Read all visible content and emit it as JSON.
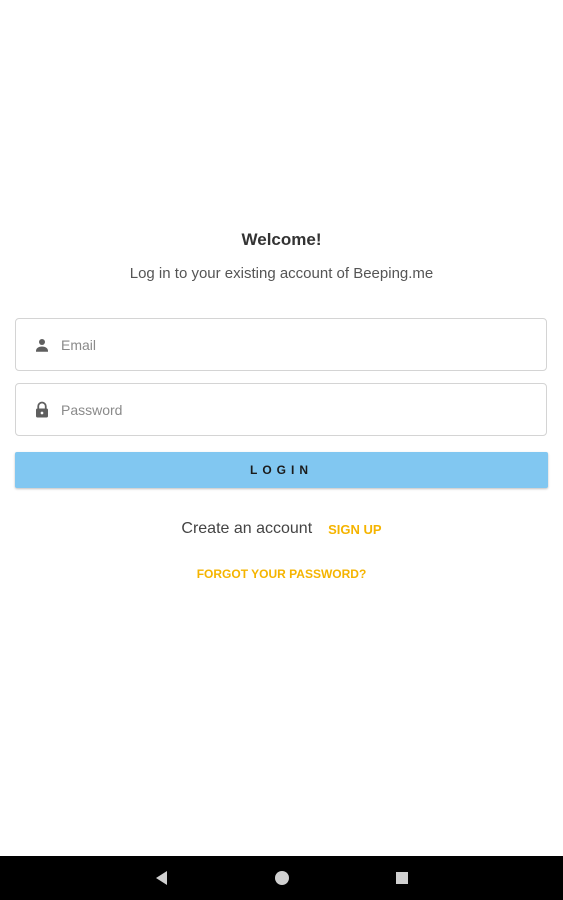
{
  "login": {
    "title": "Welcome!",
    "subtitle": "Log in to your existing account of Beeping.me",
    "email": {
      "placeholder": "Email",
      "value": "",
      "icon": "person-icon"
    },
    "password": {
      "placeholder": "Password",
      "value": "",
      "icon": "lock-icon"
    },
    "login_button": "LOGIN",
    "create_account_text": "Create an account",
    "signup_link": "SIGN UP",
    "forgot_password_link": "FORGOT YOUR PASSWORD?"
  },
  "navigation_bar": {
    "buttons": [
      "back-icon",
      "home-icon",
      "recents-icon"
    ]
  },
  "colors": {
    "accent": "#81c7f1",
    "link": "#f5b400",
    "nav_bar": "#000000"
  }
}
